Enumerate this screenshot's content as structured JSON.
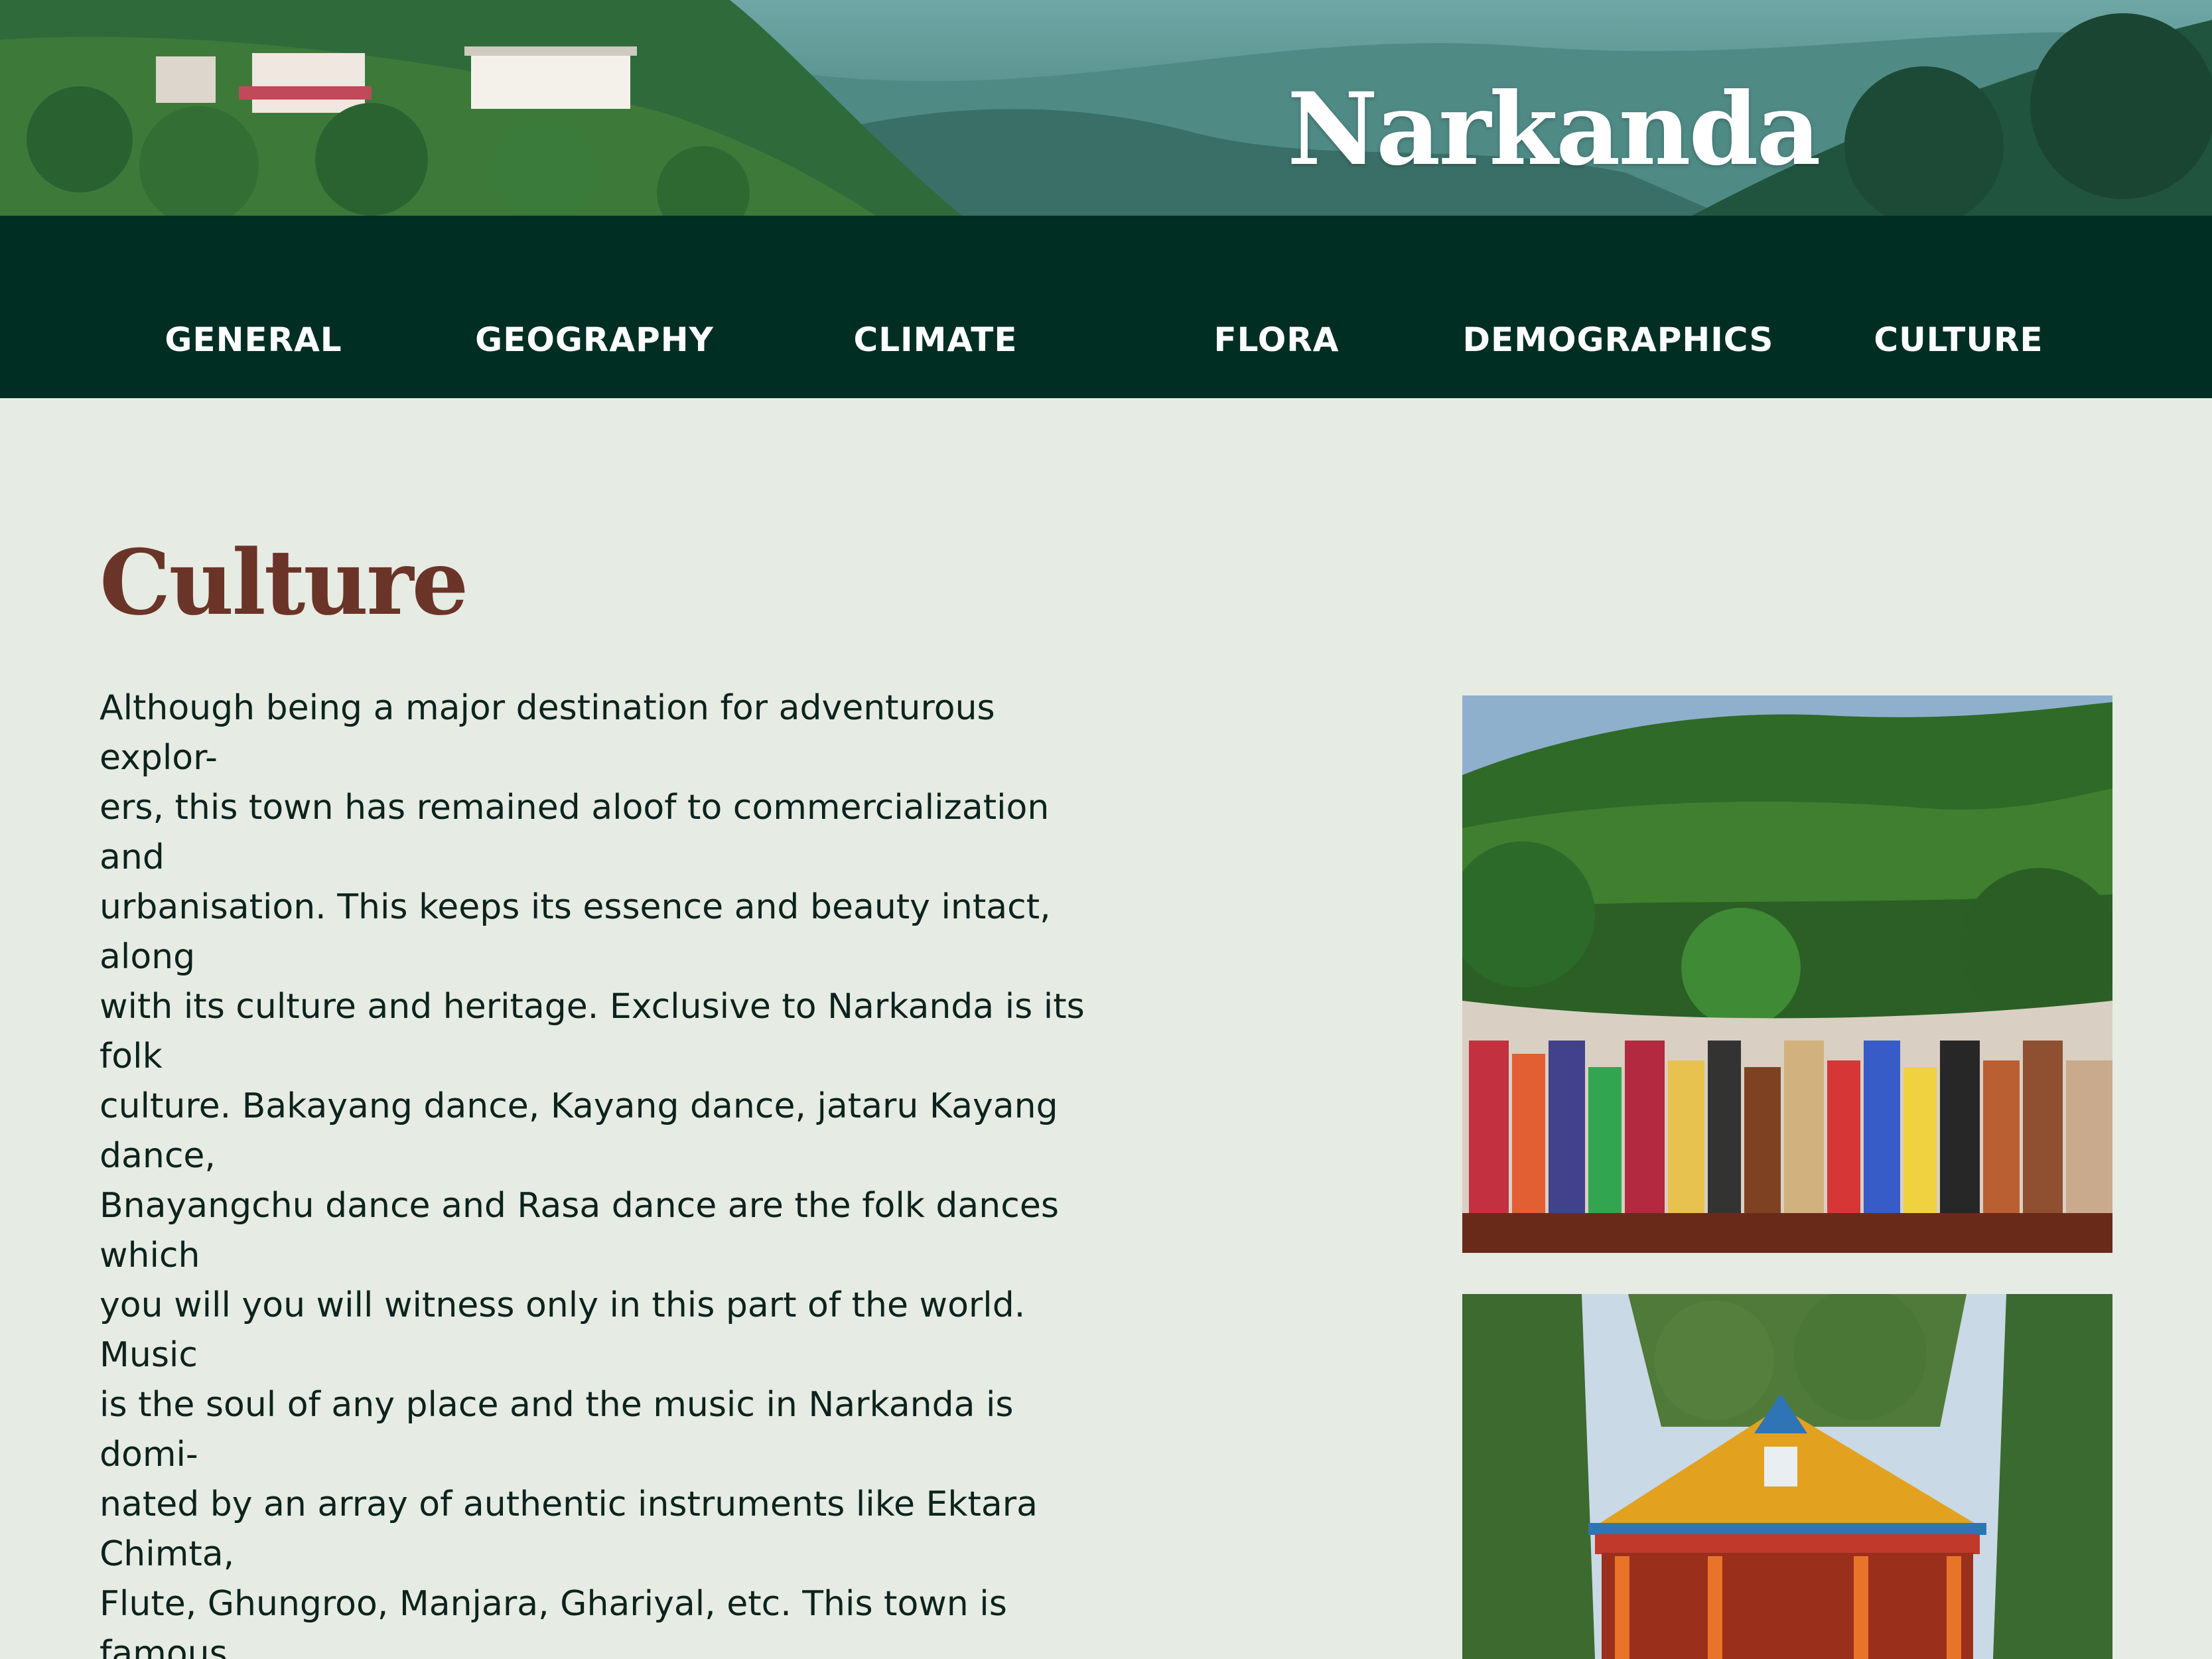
{
  "hero": {
    "title": "Narkanda"
  },
  "nav": {
    "items": [
      {
        "label": "GENERAL"
      },
      {
        "label": "GEOGRAPHY"
      },
      {
        "label": "CLIMATE"
      },
      {
        "label": "FLORA"
      },
      {
        "label": "DEMOGRAPHICS"
      },
      {
        "label": "CULTURE"
      }
    ]
  },
  "section": {
    "title": "Culture",
    "body": "Although being a major destination for adventurous explor-\ners, this town has remained aloof to commercialization and\nurbanisation. This keeps its essence and beauty intact, along\nwith its culture and heritage. Exclusive to Narkanda is its folk\nculture. Bakayang dance, Kayang dance, jataru Kayang dance,\nBnayangchu dance and Rasa dance are the folk dances which\nyou will you will witness only in this part of the world. Music\nis the soul of any place and the music in Narkanda is domi-\nnated by an array of authentic instruments like Ektara Chimta,\nFlute, Ghungroo, Manjara, Ghariyal, etc. This town is famous\nfor its indigenous music. Sung by the locals with their heart\nand soul, this music is absolutely pleasant to hear. In the true\nsecular style, you will see the inhabitants celebrating Diwali\nand Holi with as much zeal as they would celebrate Christmas\nor Lohri with. Along with nature, this town has been gifted\nwith art too. Bamboo items and metal artefacts and jewellery\nmade by the tribes of this area, are world-famous. You can\ntake beautiful souvenirs with you, back home. The cuisine of\nthis little town has a pure Himachali influence, with simple,\nlip-smacking dishes. Their meaty delights are spicy, to suit the"
  },
  "colors": {
    "nav_background": "#002e23",
    "page_background": "#e6ebe3",
    "heading": "#6b3428",
    "body_text": "#0c231d"
  }
}
